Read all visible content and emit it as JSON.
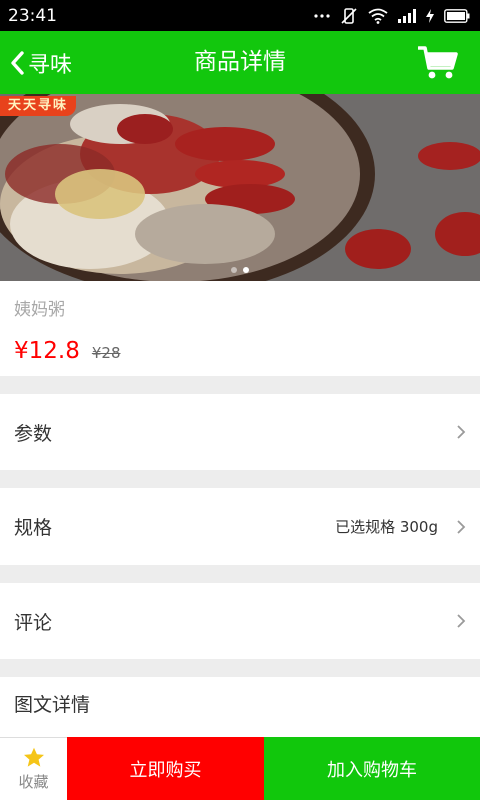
{
  "status_bar": {
    "time": "23:41"
  },
  "nav": {
    "back_label": "寻味",
    "title": "商品详情"
  },
  "banner": {
    "tag": "天天寻味",
    "slide_count": 2,
    "active_slide": 1
  },
  "product": {
    "name": "姨妈粥",
    "price": "¥12.8",
    "original_price": "¥28"
  },
  "rows": {
    "params_label": "参数",
    "spec_label": "规格",
    "spec_value": "已选规格 300g",
    "reviews_label": "评论",
    "detail_label": "图文详情"
  },
  "bottom": {
    "favorite_label": "收藏",
    "buy_now_label": "立即购买",
    "add_cart_label": "加入购物车"
  },
  "colors": {
    "brand_green": "#12c70d",
    "price_red": "#ff0000",
    "buy_red": "#ff0000",
    "star_yellow": "#f5c518"
  }
}
